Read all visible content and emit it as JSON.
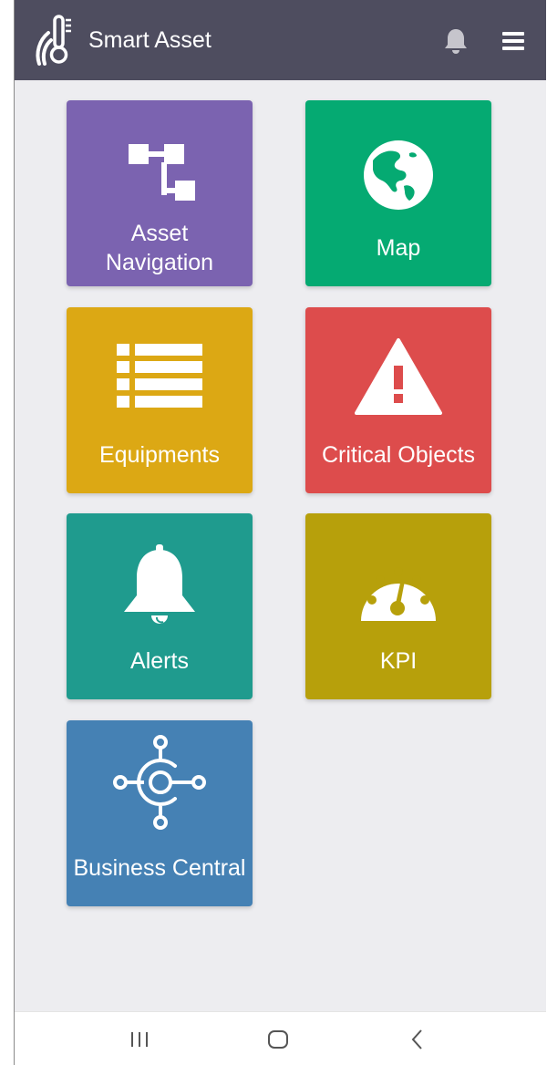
{
  "app": {
    "title": "Smart Asset",
    "logo_icon": "thermometer-signal-logo",
    "header_color": "#4e4d5f",
    "background_color": "#ededf0"
  },
  "header": {
    "notifications_icon": "bell-icon",
    "menu_icon": "hamburger-menu-icon"
  },
  "tiles": [
    {
      "label_line1": "Asset",
      "label_line2": "Navigation",
      "icon": "hierarchy-tree-icon",
      "color": "#7b63b0"
    },
    {
      "label": "Map",
      "icon": "globe-americas-icon",
      "color": "#05aa72"
    },
    {
      "label": "Equipments",
      "icon": "list-icon",
      "color": "#dca814"
    },
    {
      "label": "Critical Objects",
      "icon": "warning-triangle-icon",
      "color": "#dd4c4c"
    },
    {
      "label": "Alerts",
      "icon": "bell-icon",
      "color": "#1f9b8e"
    },
    {
      "label": "KPI",
      "icon": "gauge-icon",
      "color": "#b7a00b"
    },
    {
      "label": "Business Central",
      "icon": "hub-connector-icon",
      "color": "#4581b4"
    }
  ],
  "system_nav": {
    "recents_icon": "recent-apps-icon",
    "home_icon": "home-icon",
    "back_icon": "back-icon"
  }
}
